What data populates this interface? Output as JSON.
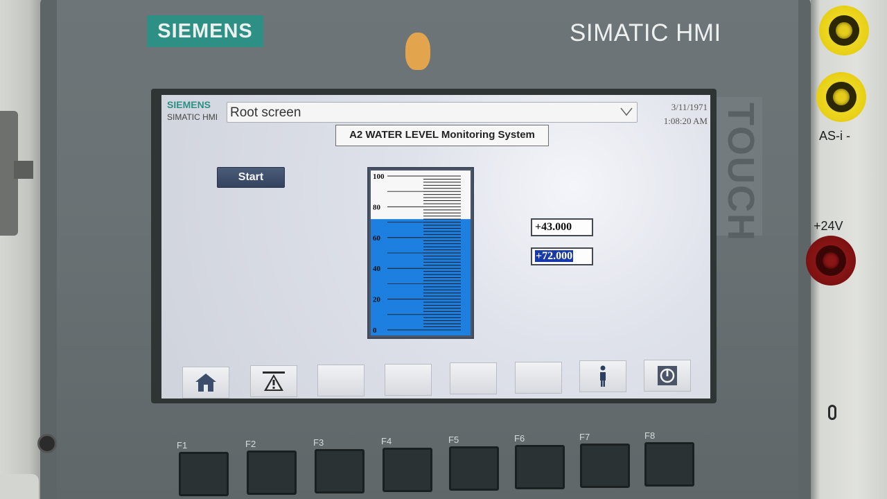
{
  "device": {
    "brand": "SIEMENS",
    "model": "SIMATIC HMI",
    "touch_label": "TOUCH"
  },
  "screen": {
    "brand": "SIEMENS",
    "model": "SIMATIC HMI",
    "screen_selector": "Root screen",
    "date": "3/11/1971",
    "time": "1:08:20 AM",
    "title": "A2 WATER LEVEL Monitoring System",
    "start_label": "Start",
    "gauge": {
      "min": 0,
      "max": 100,
      "level": 72,
      "ticks": [
        "0",
        "20",
        "40",
        "60",
        "80",
        "100"
      ],
      "fill_color": "#1d7fe0"
    },
    "values": {
      "value_a": "+43.000",
      "value_b": "+72.000"
    },
    "function_buttons": [
      {
        "icon": "home-icon"
      },
      {
        "icon": "alarm-warning-icon"
      },
      {
        "icon": ""
      },
      {
        "icon": ""
      },
      {
        "icon": ""
      },
      {
        "icon": ""
      },
      {
        "icon": "info-person-icon"
      },
      {
        "icon": "power-icon"
      }
    ]
  },
  "fkeys": [
    "F1",
    "F2",
    "F3",
    "F4",
    "F5",
    "F6",
    "F7",
    "F8"
  ],
  "rail": {
    "label_asi": "AS-i -",
    "label_24v": "+24V"
  }
}
